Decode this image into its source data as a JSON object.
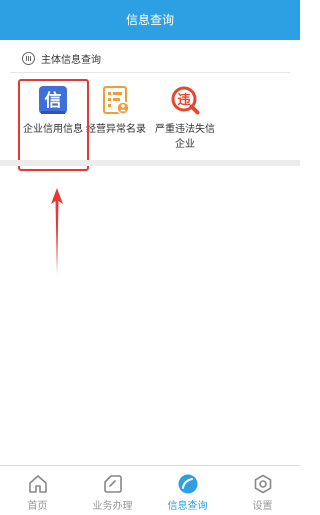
{
  "header": {
    "title": "信息查询"
  },
  "section": {
    "title": "主体信息查询"
  },
  "items": [
    {
      "label": "企业信用信息",
      "icon": "credit-info-icon",
      "glyph": "信"
    },
    {
      "label": "经营异常名录",
      "icon": "business-anomaly-list-icon"
    },
    {
      "label": "严重违法失信企业",
      "icon": "serious-violation-icon",
      "glyph": "违"
    }
  ],
  "tabs": [
    {
      "label": "首页",
      "icon": "home-icon",
      "active": false
    },
    {
      "label": "业务办理",
      "icon": "business-icon",
      "active": false
    },
    {
      "label": "信息查询",
      "icon": "info-query-icon",
      "active": true
    },
    {
      "label": "设置",
      "icon": "settings-icon",
      "active": false
    }
  ],
  "colors": {
    "brand": "#2da0e4",
    "highlight": "#e53935",
    "credit_icon": "#3f6fd9",
    "anomaly_icon": "#f39c3b",
    "violation_icon": "#e8472e"
  }
}
